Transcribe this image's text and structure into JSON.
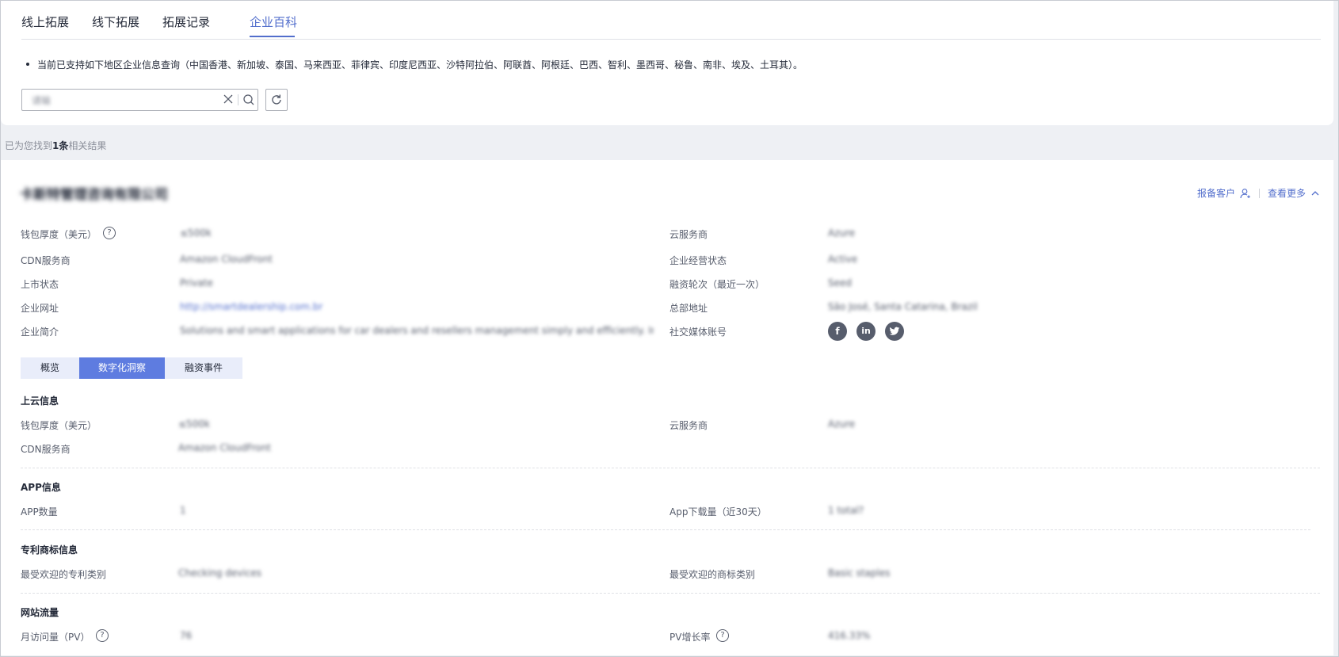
{
  "tabs": [
    "线上拓展",
    "线下拓展",
    "拓展记录",
    "企业百科"
  ],
  "active_tab": "企业百科",
  "notice": "当前已支持如下地区企业信息查询（中国香港、新加坡、泰国、马来西亚、菲律宾、印度尼西亚、沙特阿拉伯、阿联酋、阿根廷、巴西、智利、墨西哥、秘鲁、南非、埃及、土耳其）。",
  "search": {
    "value": "请输"
  },
  "result": {
    "prefix": "已为您找到",
    "count": "1条",
    "suffix": "相关结果"
  },
  "company": {
    "name": "卡斯特管理咨询有限公司",
    "report_label": "报备客户",
    "more_label": "查看更多",
    "fields": {
      "wallet_label": "钱包厚度（美元）",
      "wallet_value": "≤500k",
      "cloud_label": "云服务商",
      "cloud_value": "Azure",
      "cdn_label": "CDN服务商",
      "cdn_value": "Amazon CloudFront",
      "status_label": "企业经营状态",
      "status_value": "Active",
      "listing_label": "上市状态",
      "listing_value": "Private",
      "funding_label": "融资轮次（最近一次）",
      "funding_value": "Seed",
      "website_label": "企业网址",
      "website_value": "http://smartdealership.com.br",
      "hq_label": "总部地址",
      "hq_value": "São José, Santa Catarina, Brazil",
      "intro_label": "企业简介",
      "intro_value": "Solutions and smart applications for car dealers and resellers management simply and efficiently. Integratio...",
      "social_label": "社交媒体账号"
    },
    "social": [
      "facebook",
      "linkedin",
      "twitter"
    ]
  },
  "subtabs": [
    "概览",
    "数字化洞察",
    "融资事件"
  ],
  "active_subtab": "数字化洞察",
  "sections": {
    "cloud": {
      "title": "上云信息",
      "wallet_label": "钱包厚度（美元）",
      "wallet_value": "≤500k",
      "cloud_label": "云服务商",
      "cloud_value": "Azure",
      "cdn_label": "CDN服务商",
      "cdn_value": "Amazon CloudFront"
    },
    "app": {
      "title": "APP信息",
      "count_label": "APP数量",
      "count_value": "1",
      "downloads_label": "App下载量（近30天）",
      "downloads_value": "1 total?"
    },
    "patent": {
      "title": "专利商标信息",
      "patent_label": "最受欢迎的专利类别",
      "patent_value": "Checking devices",
      "trademark_label": "最受欢迎的商标类别",
      "trademark_value": "Basic staples"
    },
    "traffic": {
      "title": "网站流量",
      "pv_label": "月访问量（PV）",
      "pv_value": "76",
      "growth_label": "PV增长率",
      "growth_value": "416.33%"
    }
  }
}
